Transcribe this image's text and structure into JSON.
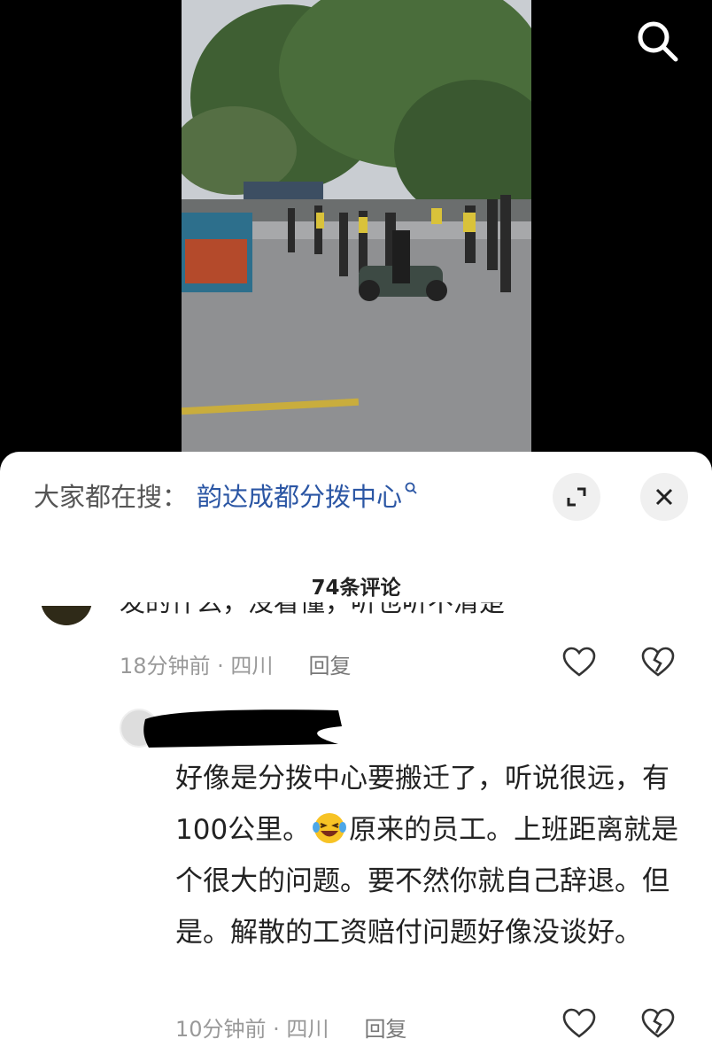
{
  "hot_search": {
    "label": "大家都在搜：",
    "term": "韵达成都分拨中心"
  },
  "comments_header": {
    "count_label": "74条评论"
  },
  "comments": [
    {
      "text": "发的什么，没看懂，听也听不清楚",
      "time_location": "18分钟前 · 四川",
      "reply_label": "回复"
    },
    {
      "text_part1": "好像是分拨中心要搬迁了，听说很远，有100公里。",
      "emoji": "laughing-crying-emoji",
      "text_part2": "原来的员工。上班距离就是个很大的问题。要不然你就自己辞退。但是。解散的工资赔付问题好像没谈好。",
      "time_location": "10分钟前 · 四川",
      "reply_label": "回复"
    }
  ],
  "colors": {
    "accent_link": "#2b56a4",
    "meta_gray": "#999999",
    "sheet_bg": "#ffffff",
    "page_bg": "#000000"
  },
  "icons": [
    "search-icon",
    "expand-icon",
    "close-icon",
    "heart-icon",
    "broken-heart-icon"
  ]
}
